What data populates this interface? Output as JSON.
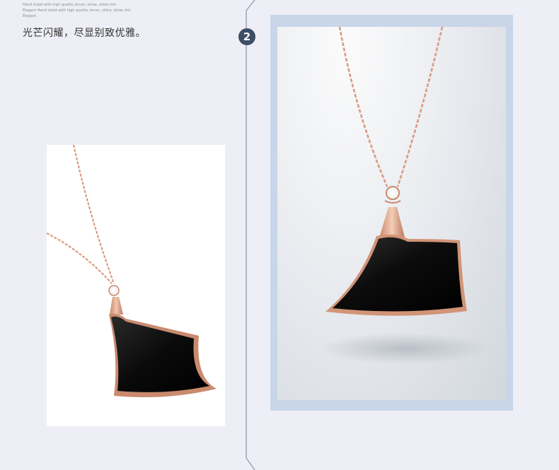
{
  "caption": {
    "english_lines": [
      "Hand inlaid with high quality zircon, shine, show chic",
      "Elegant.Hand inlaid with high quality zircon, shine, show chic",
      "Elegant."
    ],
    "chinese": "光芒闪耀，尽显别致优雅。"
  },
  "section_number": "2",
  "colors": {
    "background": "#eeeff6",
    "badge": "#3d4e67",
    "frame": "#c9d5e8",
    "rose_gold": "#d69a80",
    "onyx": "#0c0c0c"
  },
  "images": {
    "left": {
      "icon": "necklace-pendant-photo"
    },
    "right": {
      "icon": "necklace-pendant-closeup-photo"
    }
  }
}
